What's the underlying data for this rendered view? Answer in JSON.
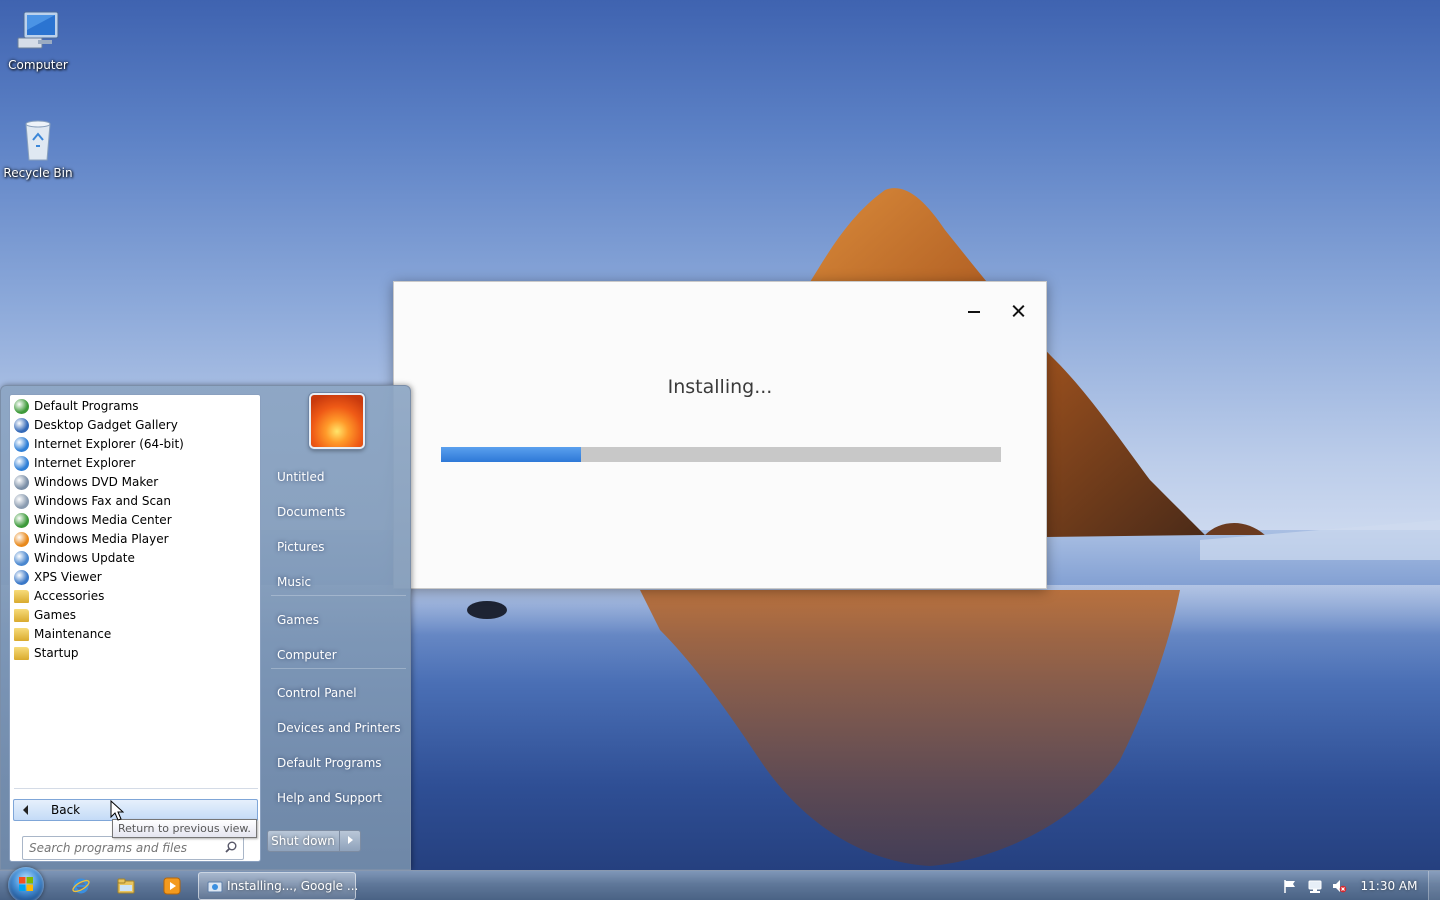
{
  "desktop": {
    "icons": [
      {
        "label": "Computer",
        "icon": "computer-icon"
      },
      {
        "label": "Recycle Bin",
        "icon": "recycle-bin-icon"
      }
    ]
  },
  "installer": {
    "status": "Installing...",
    "progress_percent": 25,
    "controls": {
      "minimize": "minimize-icon",
      "close": "close-icon"
    }
  },
  "start_menu": {
    "programs": [
      {
        "label": "Default Programs",
        "icon": "default-programs-icon",
        "color": "#3e9a3a"
      },
      {
        "label": "Desktop Gadget Gallery",
        "icon": "gadget-gallery-icon",
        "color": "#3469b8"
      },
      {
        "label": "Internet Explorer (64-bit)",
        "icon": "internet-explorer-icon",
        "color": "#2f7fd6"
      },
      {
        "label": "Internet Explorer",
        "icon": "internet-explorer-icon",
        "color": "#2f7fd6"
      },
      {
        "label": "Windows DVD Maker",
        "icon": "dvd-maker-icon",
        "color": "#7a8ea6"
      },
      {
        "label": "Windows Fax and Scan",
        "icon": "fax-scan-icon",
        "color": "#8a9bb0"
      },
      {
        "label": "Windows Media Center",
        "icon": "media-center-icon",
        "color": "#3c9a3a"
      },
      {
        "label": "Windows Media Player",
        "icon": "media-player-icon",
        "color": "#e8891c"
      },
      {
        "label": "Windows Update",
        "icon": "windows-update-icon",
        "color": "#4a87cf"
      },
      {
        "label": "XPS Viewer",
        "icon": "xps-viewer-icon",
        "color": "#3a78c8"
      },
      {
        "label": "Accessories",
        "icon": "folder-icon",
        "color": "#e5bf4a"
      },
      {
        "label": "Games",
        "icon": "folder-icon",
        "color": "#e5bf4a"
      },
      {
        "label": "Maintenance",
        "icon": "folder-icon",
        "color": "#e5bf4a"
      },
      {
        "label": "Startup",
        "icon": "folder-icon",
        "color": "#e5bf4a"
      }
    ],
    "back_label": "Back",
    "search_placeholder": "Search programs and files",
    "right_links": [
      "Untitled",
      "Documents",
      "Pictures",
      "Music",
      "Games",
      "Computer",
      "Control Panel",
      "Devices and Printers",
      "Default Programs",
      "Help and Support"
    ],
    "shutdown_label": "Shut down"
  },
  "tooltip": "Return to previous view.",
  "taskbar": {
    "pinned": [
      "internet-explorer-icon",
      "windows-explorer-icon",
      "media-player-icon"
    ],
    "task_label": "Installing..., Google ...",
    "tray_icons": [
      "action-center-flag-icon",
      "network-icon",
      "volume-muted-icon"
    ],
    "clock": "11:30 AM"
  }
}
